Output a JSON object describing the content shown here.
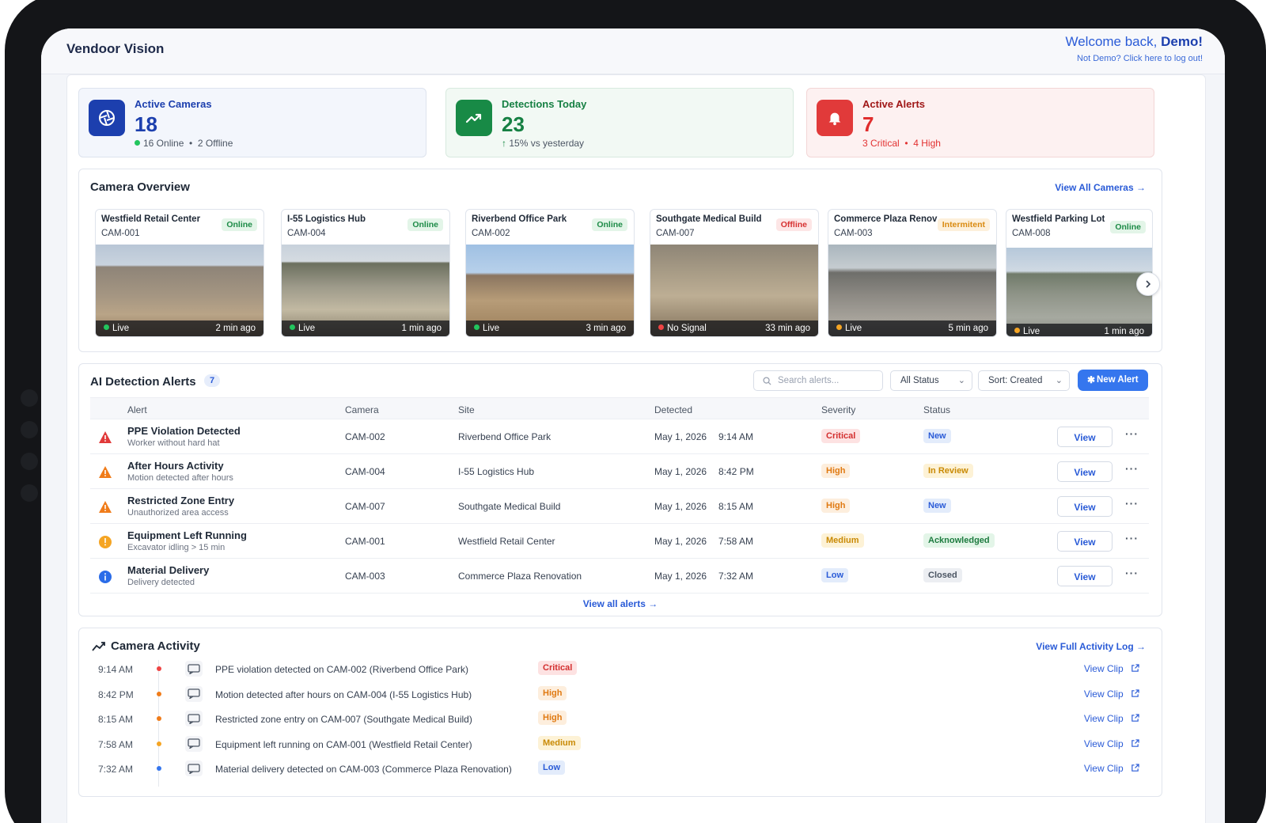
{
  "app": {
    "title": "Vendoor Vision"
  },
  "header": {
    "welcome_prefix": "Welcome back, ",
    "user_name": "Demo!",
    "logout_text": "Not Demo? Click here to log out!"
  },
  "stats": {
    "cameras": {
      "label": "Active Cameras",
      "value": "18",
      "online": "16 Online",
      "sep": "•",
      "offline": "2 Offline"
    },
    "detections": {
      "label": "Detections Today",
      "value": "23",
      "trend": "15% vs yesterday"
    },
    "alerts": {
      "label": "Active Alerts",
      "value": "7",
      "critical": "3 Critical",
      "sep": "•",
      "high": "4 High"
    }
  },
  "camera_overview": {
    "title": "Camera Overview",
    "link": "View All Cameras",
    "cameras": [
      {
        "site": "Westfield Retail Center",
        "id": "CAM-001",
        "status": "Online",
        "feed": "Live",
        "updated": "2 min ago",
        "dot": "#22c55e"
      },
      {
        "site": "I-55 Logistics Hub",
        "id": "CAM-004",
        "status": "Online",
        "feed": "Live",
        "updated": "1 min ago",
        "dot": "#22c55e"
      },
      {
        "site": "Riverbend Office Park",
        "id": "CAM-002",
        "status": "Online",
        "feed": "Live",
        "updated": "3 min ago",
        "dot": "#22c55e"
      },
      {
        "site": "Southgate Medical Build",
        "id": "CAM-007",
        "status": "Offline",
        "feed": "No Signal",
        "updated": "33 min ago",
        "dot": "#ef4444"
      },
      {
        "site": "Commerce Plaza Renov",
        "id": "CAM-003",
        "status": "Intermitent",
        "feed": "Live",
        "updated": "5 min ago",
        "dot": "#f5a524"
      },
      {
        "site": "Westfield Parking Lot",
        "id": "CAM-008",
        "status": "Online",
        "feed": "Live",
        "updated": "1 min ago",
        "dot": "#f5a524"
      }
    ]
  },
  "alerts": {
    "title": "AI Detection Alerts",
    "count": "7",
    "search_placeholder": "Search alerts...",
    "status_filter": "All Status",
    "sort": "Sort: Created",
    "new_button": "New Alert",
    "columns": {
      "alert": "Alert",
      "camera": "Camera",
      "site": "Site",
      "detected": "Detected",
      "severity": "Severity",
      "status": "Status"
    },
    "view_label": "View",
    "rows": [
      {
        "icon": "warning-red-icon",
        "title": "PPE Violation Detected",
        "desc": "Worker without hard hat",
        "camera": "CAM-002",
        "site": "Riverbend Office Park",
        "date": "May 1, 2026",
        "time": "9:14 AM",
        "severity": "Critical",
        "status": "New"
      },
      {
        "icon": "warning-orange-icon",
        "title": "After Hours Activity",
        "desc": "Motion detected after hours",
        "camera": "CAM-004",
        "site": "I-55 Logistics Hub",
        "date": "May 1, 2026",
        "time": "8:42 PM",
        "severity": "High",
        "status": "In Review"
      },
      {
        "icon": "warning-orange-icon",
        "title": "Restricted Zone Entry",
        "desc": "Unauthorized area access",
        "camera": "CAM-007",
        "site": "Southgate Medical Build",
        "date": "May 1, 2026",
        "time": "8:15 AM",
        "severity": "High",
        "status": "New"
      },
      {
        "icon": "exclamation-yellow-icon",
        "title": "Equipment Left Running",
        "desc": "Excavator idling > 15 min",
        "camera": "CAM-001",
        "site": "Westfield Retail Center",
        "date": "May 1, 2026",
        "time": "7:58 AM",
        "severity": "Medium",
        "status": "Acknowledged"
      },
      {
        "icon": "info-blue-icon",
        "title": "Material Delivery",
        "desc": "Delivery detected",
        "camera": "CAM-003",
        "site": "Commerce Plaza Renovation",
        "date": "May 1, 2026",
        "time": "7:32 AM",
        "severity": "Low",
        "status": "Closed"
      }
    ],
    "view_all": "View all alerts"
  },
  "activity": {
    "title": "Camera Activity",
    "link": "View Full Activity Log",
    "clip_label": "View Clip",
    "rows": [
      {
        "time": "9:14 AM",
        "message": "PPE violation detected on CAM-002 (Riverbend Office Park)",
        "severity": "Critical",
        "dot": "#ef4444"
      },
      {
        "time": "8:42 PM",
        "message": "Motion detected after hours on CAM-004 (I-55 Logistics Hub)",
        "severity": "High",
        "dot": "#f07c1a"
      },
      {
        "time": "8:15 AM",
        "message": "Restricted zone entry on CAM-007 (Southgate Medical Build)",
        "severity": "High",
        "dot": "#f07c1a"
      },
      {
        "time": "7:58 AM",
        "message": "Equipment left running on CAM-001 (Westfield Retail Center)",
        "severity": "Medium",
        "dot": "#f5a524"
      },
      {
        "time": "7:32 AM",
        "message": "Material delivery detected on CAM-003 (Commerce Plaza Renovation)",
        "severity": "Low",
        "dot": "#3576ee"
      }
    ]
  },
  "colors": {
    "brand": "#1c3fae",
    "accent": "#3576ee",
    "success": "#188a46",
    "danger": "#e13a3a"
  }
}
